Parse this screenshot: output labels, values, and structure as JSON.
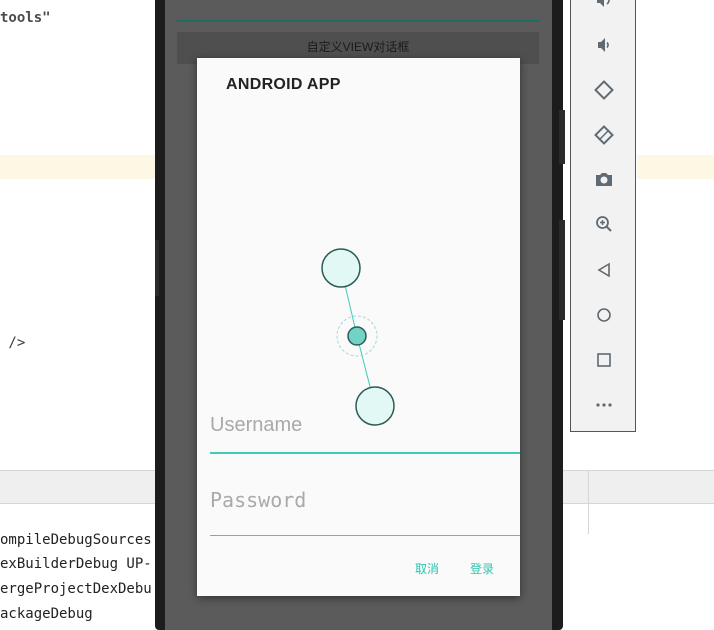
{
  "ide": {
    "code_lines": [
      {
        "text": "tools\""
      },
      {
        "text": " />"
      }
    ],
    "log_lines": [
      "ompileDebugSources",
      "exBuilderDebug UP-",
      "ergeProjectDexDebu",
      "ackageDebug"
    ]
  },
  "app": {
    "button_label": "自定义VIEW对话框"
  },
  "dialog": {
    "title": "ANDROID APP",
    "username_placeholder": "Username",
    "password_placeholder": "Password",
    "cancel_label": "取消",
    "login_label": "登录",
    "accent_color": "#3ecbb8"
  },
  "toolbar": {
    "items": [
      {
        "icon": "volume-up-icon"
      },
      {
        "icon": "volume-down-icon"
      },
      {
        "icon": "rotate-left-icon"
      },
      {
        "icon": "rotate-right-icon"
      },
      {
        "icon": "camera-icon"
      },
      {
        "icon": "zoom-icon"
      },
      {
        "icon": "back-icon"
      },
      {
        "icon": "home-icon"
      },
      {
        "icon": "overview-icon"
      },
      {
        "icon": "more-icon"
      }
    ]
  }
}
